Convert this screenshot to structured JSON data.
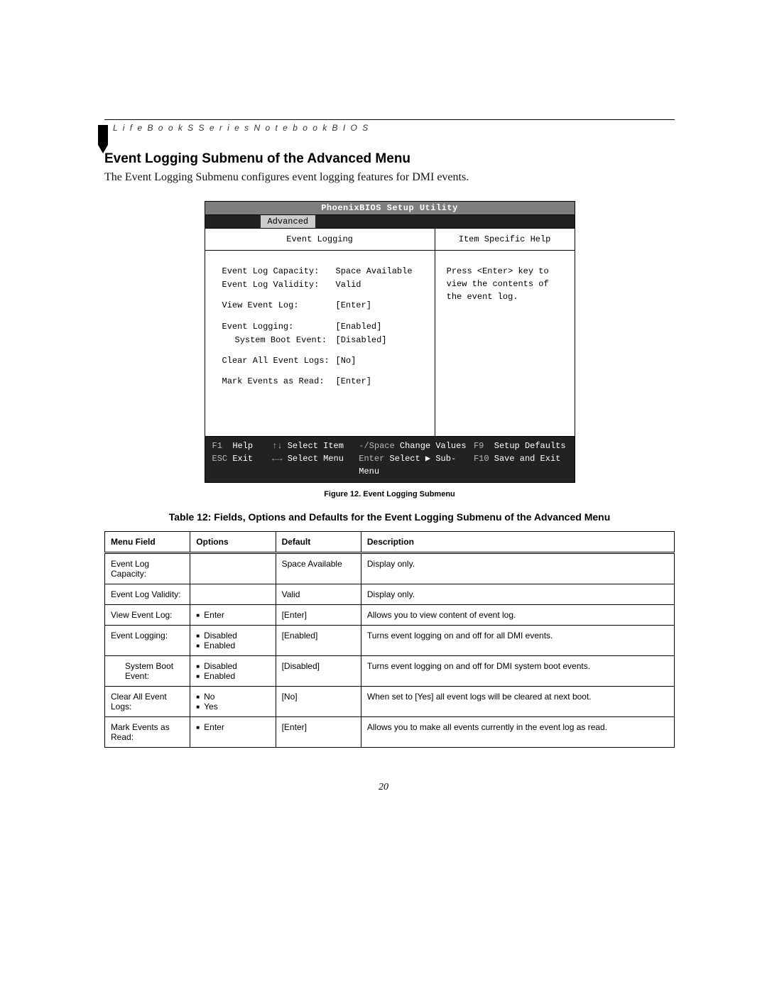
{
  "header": {
    "running_head": "L i f e B o o k   S   S e r i e s   N o t e b o o k   B I O S"
  },
  "section": {
    "title": "Event Logging Submenu of the Advanced Menu",
    "intro": "The Event Logging Submenu configures event logging features for DMI events."
  },
  "bios": {
    "title": "PhoenixBIOS Setup Utility",
    "active_tab": "Advanced",
    "left_heading": "Event Logging",
    "right_heading": "Item Specific Help",
    "fields": {
      "capacity_label": "Event Log Capacity:",
      "capacity_value": "Space Available",
      "validity_label": "Event Log Validity:",
      "validity_value": "Valid",
      "view_label": "View Event Log:",
      "view_value": "[Enter]",
      "logging_label": "Event Logging:",
      "logging_value": "[Enabled]",
      "sysboot_label": "System Boot Event:",
      "sysboot_value": "[Disabled]",
      "clear_label": "Clear All Event Logs:",
      "clear_value": "[No]",
      "mark_label": "Mark Events as Read:",
      "mark_value": "[Enter]"
    },
    "help_text": "Press <Enter> key to view the contents of the event log.",
    "footer": {
      "f1": "F1",
      "help": "Help",
      "updown": "↑↓",
      "select_item": "Select Item",
      "minus_space": "-/Space",
      "change_values": "Change Values",
      "f9": "F9",
      "setup_defaults": "Setup Defaults",
      "esc": "ESC",
      "exit": "Exit",
      "leftright": "←→",
      "select_menu": "Select Menu",
      "enter": "Enter",
      "select_sub": "Select ▶ Sub-Menu",
      "f10": "F10",
      "save_exit": "Save and Exit"
    }
  },
  "figure_caption": "Figure 12.   Event Logging Submenu",
  "table_title": "Table 12: Fields, Options and Defaults for the Event Logging Submenu of the Advanced Menu",
  "table": {
    "headers": {
      "menu_field": "Menu Field",
      "options": "Options",
      "default": "Default",
      "description": "Description"
    },
    "rows": [
      {
        "field": "Event Log Capacity:",
        "options": [],
        "default": "Space Available",
        "description": "Display only.",
        "indent": false
      },
      {
        "field": "Event Log Validity:",
        "options": [],
        "default": "Valid",
        "description": "Display only.",
        "indent": false
      },
      {
        "field": "View Event Log:",
        "options": [
          "Enter"
        ],
        "default": "[Enter]",
        "description": "Allows you to view content of event log.",
        "indent": false
      },
      {
        "field": "Event Logging:",
        "options": [
          "Disabled",
          "Enabled"
        ],
        "default": "[Enabled]",
        "description": "Turns event logging on and off for all DMI events.",
        "indent": false
      },
      {
        "field": "System Boot Event:",
        "options": [
          "Disabled",
          "Enabled"
        ],
        "default": "[Disabled]",
        "description": "Turns event logging on and off for DMI system boot events.",
        "indent": true
      },
      {
        "field": "Clear All Event Logs:",
        "options": [
          "No",
          "Yes"
        ],
        "default": "[No]",
        "description": "When set to [Yes] all event logs will be cleared at next boot.",
        "indent": false
      },
      {
        "field": "Mark Events as Read:",
        "options": [
          "Enter"
        ],
        "default": "[Enter]",
        "description": "Allows you to make all events currently in the event log as read.",
        "indent": false
      }
    ]
  },
  "page_number": "20"
}
